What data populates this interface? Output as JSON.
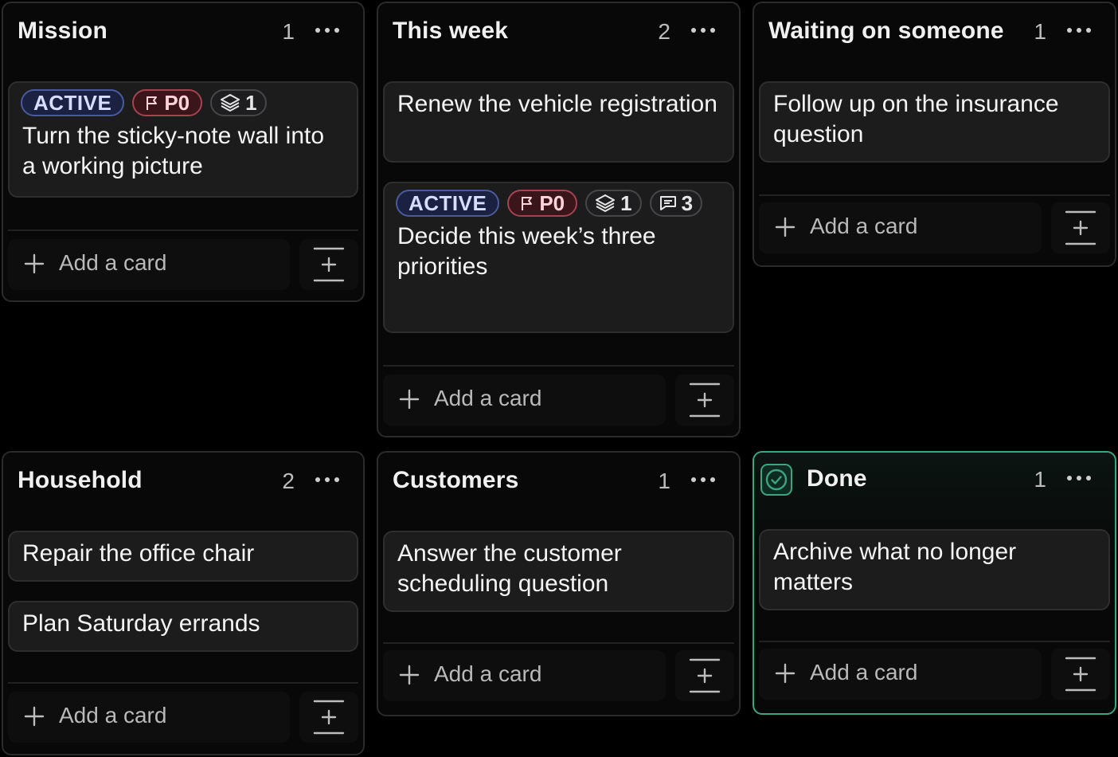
{
  "columns": [
    {
      "title": "Mission",
      "count": "1",
      "cards": [
        {
          "tags": {
            "status": "ACTIVE",
            "priority": "P0",
            "subtasks": "1"
          },
          "title": "Turn the sticky-note wall into a working picture"
        }
      ],
      "add_label": "Add a card"
    },
    {
      "title": "This week",
      "count": "2",
      "cards": [
        {
          "title": "Renew the vehicle registration"
        },
        {
          "tags": {
            "status": "ACTIVE",
            "priority": "P0",
            "subtasks": "1",
            "comments": "3"
          },
          "title": "Decide this week’s three priorities"
        }
      ],
      "add_label": "Add a card"
    },
    {
      "title": "Waiting on someone",
      "count": "1",
      "cards": [
        {
          "title": "Follow up on the insurance question"
        }
      ],
      "add_label": "Add a card"
    },
    {
      "title": "Household",
      "count": "2",
      "cards": [
        {
          "title": "Repair the office chair"
        },
        {
          "title": "Plan Saturday errands"
        }
      ],
      "add_label": "Add a card"
    },
    {
      "title": "Customers",
      "count": "1",
      "cards": [
        {
          "title": "Answer the customer scheduling question"
        }
      ],
      "add_label": "Add a card"
    },
    {
      "title": "Done",
      "count": "1",
      "cards": [
        {
          "title": "Archive what no longer matters"
        }
      ],
      "add_label": "Add a card"
    }
  ],
  "icons": {
    "menu": "more-horizontal-icon",
    "flag": "flag-icon",
    "layers": "layers-icon",
    "comment": "comment-icon",
    "plus": "plus-icon",
    "compact": "add-compact-icon",
    "done": "check-circle-icon"
  },
  "colors": {
    "done_accent": "#3aa57e",
    "active_tag": "#4b5a9c",
    "priority_tag": "#a64350"
  }
}
